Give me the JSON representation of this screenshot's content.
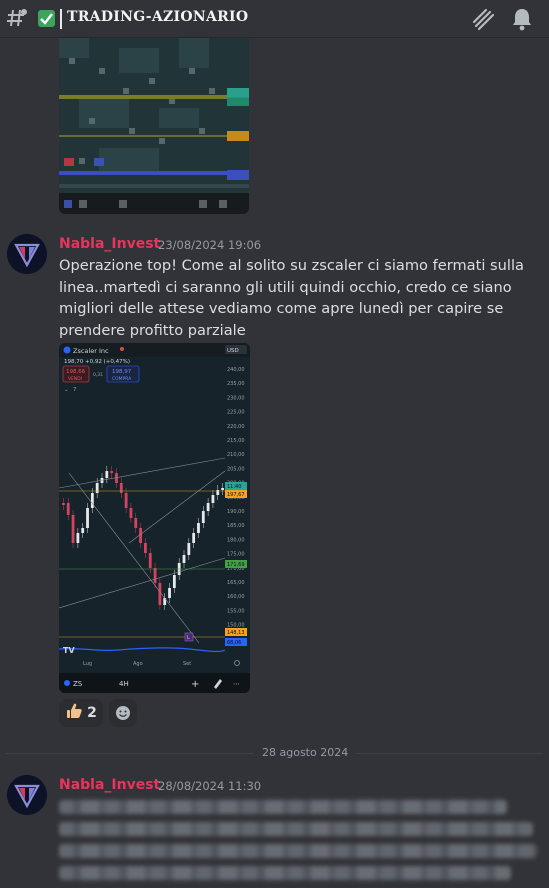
{
  "header": {
    "channel_name": "TRADING-AZIONARIO",
    "icons": [
      "threads-icon",
      "bell-icon"
    ]
  },
  "messages": [
    {
      "author": "Nabla_Invest",
      "timestamp": "23/08/2024 19:06",
      "text": "Operazione top! Come al solito su zscaler ci siamo fermati sulla linea..martedì ci saranno gli utili quindi occhio, credo ce siano migliori delle attese vediamo come apre lunedì per capire se prendere profitto parziale",
      "reactions": [
        {
          "emoji": "thumbs-up",
          "count": "2"
        }
      ]
    },
    {
      "author": "Nabla_Invest",
      "timestamp": "28/08/2024 11:30"
    }
  ],
  "divider": "28 agosto 2024",
  "chart_screenshot": {
    "title": "Zscaler Inc",
    "price_line": "198,70 +0,92 (+0,47%)",
    "sell_price": "198,66",
    "sell_label": "VENDI",
    "spread": "0,31",
    "buy_price": "198,97",
    "buy_label": "COMPRA",
    "collapse_count": "7",
    "currency": "USD",
    "axis_ticks": [
      "240,00",
      "235,00",
      "230,00",
      "225,00",
      "220,00",
      "215,00",
      "210,00",
      "205,00",
      "200,00",
      "195,00",
      "190,00",
      "185,00",
      "180,00",
      "175,00",
      "170,00",
      "165,00",
      "160,00",
      "155,00",
      "150,00"
    ],
    "price_tags": [
      {
        "value": "11:40",
        "color": "#26a69a"
      },
      {
        "value": "197,67",
        "color": "#f7a21b"
      },
      {
        "value": "171,69",
        "color": "#43a047"
      },
      {
        "value": "148,13",
        "color": "#f7a21b"
      },
      {
        "value": "68,06",
        "color": "#2962ff"
      }
    ],
    "x_labels": [
      "Lug",
      "Ago",
      "Set"
    ],
    "bottom_symbol": "ZS",
    "bottom_timeframe": "4H",
    "marker": "L"
  },
  "colors": {
    "background": "#313338",
    "author": "#e8355d",
    "text": "#dbdee1",
    "muted": "#949ba4"
  }
}
